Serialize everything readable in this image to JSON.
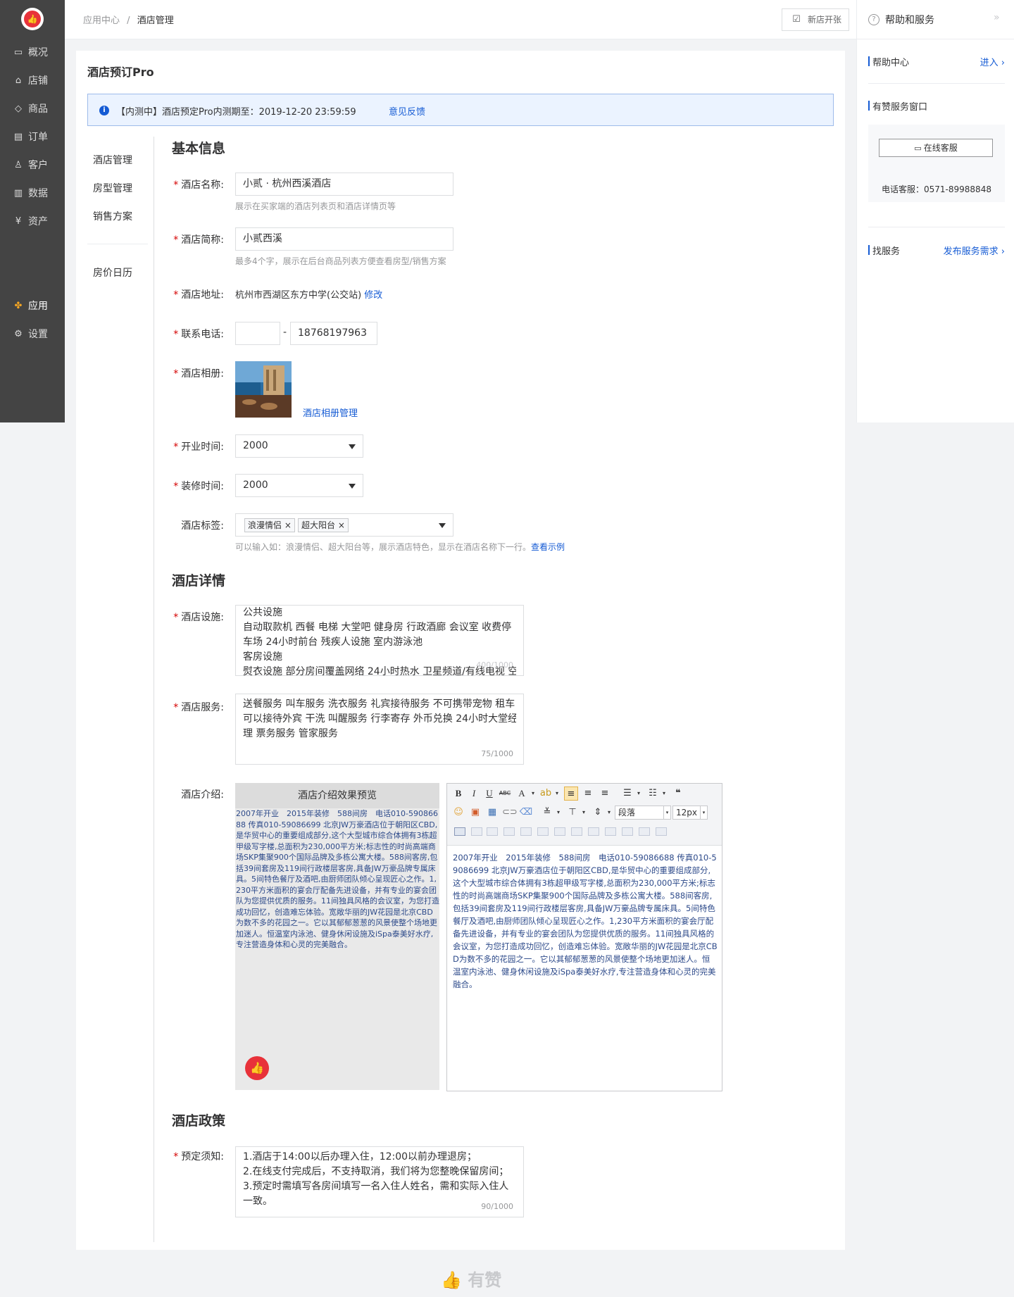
{
  "sidebar": {
    "logo_icon": "thumb-up-icon",
    "items": [
      {
        "icon": "monitor-icon",
        "glyph": "▭",
        "label": "概况"
      },
      {
        "icon": "store-icon",
        "glyph": "⌂",
        "label": "店铺"
      },
      {
        "icon": "tag-icon",
        "glyph": "◇",
        "label": "商品"
      },
      {
        "icon": "order-icon",
        "glyph": "▤",
        "label": "订单"
      },
      {
        "icon": "user-icon",
        "glyph": "♙",
        "label": "客户"
      },
      {
        "icon": "chart-icon",
        "glyph": "▥",
        "label": "数据"
      },
      {
        "icon": "yen-icon",
        "glyph": "¥",
        "label": "资产"
      }
    ],
    "bottom_items": [
      {
        "icon": "apps-icon",
        "glyph": "✤",
        "label": "应用"
      },
      {
        "icon": "gear-icon",
        "glyph": "⚙",
        "label": "设置"
      }
    ]
  },
  "breadcrumb": {
    "parent": "应用中心",
    "separator": "/",
    "current": "酒店管理"
  },
  "topbar": {
    "new_shop_label": "新店开张"
  },
  "help_panel": {
    "title": "帮助和服务",
    "help_center": {
      "title": "帮助中心",
      "link": "进入"
    },
    "service_window": {
      "title": "有赞服务窗口",
      "button": "在线客服",
      "phone": "电话客服：0571-89988848"
    },
    "find_service": {
      "title": "找服务",
      "link": "发布服务需求"
    }
  },
  "page": {
    "title": "酒店预订Pro",
    "notice": {
      "text": "【内测中】酒店预定Pro内测期至：2019-12-20 23:59:59",
      "link": "意见反馈"
    },
    "subnav": [
      "酒店管理",
      "房型管理",
      "销售方案",
      "房价日历"
    ]
  },
  "form": {
    "basic_title": "基本信息",
    "name": {
      "label": "酒店名称:",
      "value": "小贰 · 杭州西溪酒店",
      "hint": "展示在买家端的酒店列表页和酒店详情页等"
    },
    "short_name": {
      "label": "酒店简称:",
      "value": "小贰西溪",
      "hint": "最多4个字，展示在后台商品列表方便查看房型/销售方案"
    },
    "address": {
      "label": "酒店地址:",
      "value": "杭州市西湖区东方中学(公交站)",
      "link": "修改"
    },
    "phone": {
      "label": "联系电话:",
      "area": "",
      "dash": "-",
      "number": "18768197963"
    },
    "album": {
      "label": "酒店相册:",
      "link": "酒店相册管理"
    },
    "open_time": {
      "label": "开业时间:",
      "value": "2000"
    },
    "renovate_time": {
      "label": "装修时间:",
      "value": "2000"
    },
    "tags": {
      "label": "酒店标签:",
      "items": [
        "浪漫情侣",
        "超大阳台"
      ],
      "hint": "可以输入如：浪漫情侣、超大阳台等，展示酒店特色，显示在酒店名称下一行。",
      "hint_link": "查看示例"
    },
    "detail_title": "酒店详情",
    "facilities": {
      "label": "酒店设施:",
      "lines": [
        "公共设施",
        "自动取款机 西餐 电梯 大堂吧 健身房 行政酒廊 会议室 收费停",
        "车场 24小时前台 残疾人设施 室内游泳池",
        "客房设施",
        "熨衣设施 部分房间覆盖网络 24小时热水 卫星频道/有线电视 空"
      ],
      "count": "400/1000"
    },
    "services": {
      "label": "酒店服务:",
      "lines": [
        "送餐服务 叫车服务 洗衣服务 礼宾接待服务 不可携带宠物 租车",
        " 可以接待外宾 干洗 叫醒服务 行李寄存 外币兑换 24小时大堂经",
        "理 票务服务 管家服务"
      ],
      "count": "75/1000"
    },
    "intro": {
      "label": "酒店介绍:",
      "preview_title": "酒店介绍效果预览",
      "preview_text": "2007年开业　2015年装修　588间房　电话010-59086688 传真010-59086699 北京JW万豪酒店位于朝阳区CBD,是华贸中心的重要组成部分,这个大型城市综合体拥有3栋超甲级写字楼,总面积为230,000平方米;标志性的时尚高端商场SKP集聚900个国际品牌及多栋公寓大楼。588间客房,包括39间套房及119间行政楼层客房,具备JW万豪品牌专属床具。5间特色餐厅及酒吧,由厨师团队倾心呈现匠心之作。1,230平方米面积的宴会厅配备先进设备，并有专业的宴会团队为您提供优质的服务。11间独具风格的会议室，为您打造成功回忆，创造难忘体验。宽敞华丽的JW花园是北京CBD为数不多的花园之一。它以其郁郁葱葱的风景使整个场地更加迷人。恒温室内泳池、健身休闲设施及iSpa泰美好水疗,专注营造身体和心灵的完美融合。",
      "editor_text": "2007年开业　2015年装修　588间房　电话010-59086688 传真010-59086699 北京JW万豪酒店位于朝阳区CBD,是华贸中心的重要组成部分,这个大型城市综合体拥有3栋超甲级写字楼,总面积为230,000平方米;标志性的时尚高端商场SKP集聚900个国际品牌及多栋公寓大楼。588间客房,包括39间套房及119间行政楼层客房,具备JW万豪品牌专属床具。5间特色餐厅及酒吧,由厨师团队倾心呈现匠心之作。1,230平方米面积的宴会厅配备先进设备，并有专业的宴会团队为您提供优质的服务。11间独具风格的会议室，为您打造成功回忆，创造难忘体验。宽敞华丽的JW花园是北京CBD为数不多的花园之一。它以其郁郁葱葱的风景使整个场地更加迷人。恒温室内泳池、健身休闲设施及iSpa泰美好水疗,专注营造身体和心灵的完美融合。",
      "toolbar": {
        "bold": "B",
        "italic": "I",
        "underline": "U",
        "strike": "ABC",
        "font_color": "A",
        "paragraph": "段落",
        "font_size": "12px",
        "quote": "❝"
      }
    },
    "policy_title": "酒店政策",
    "booking_notes": {
      "label": "预定须知:",
      "lines": [
        "1.酒店于14:00以后办理入住，12:00以前办理退房；",
        "2.在线支付完成后，不支持取消，我们将为您整晚保留房间；",
        "3.预定时需填写各房间填写一名入住人姓名，需和实际入住人",
        "一致。"
      ],
      "count": "90/1000"
    }
  },
  "footer": {
    "brand": "有赞"
  }
}
